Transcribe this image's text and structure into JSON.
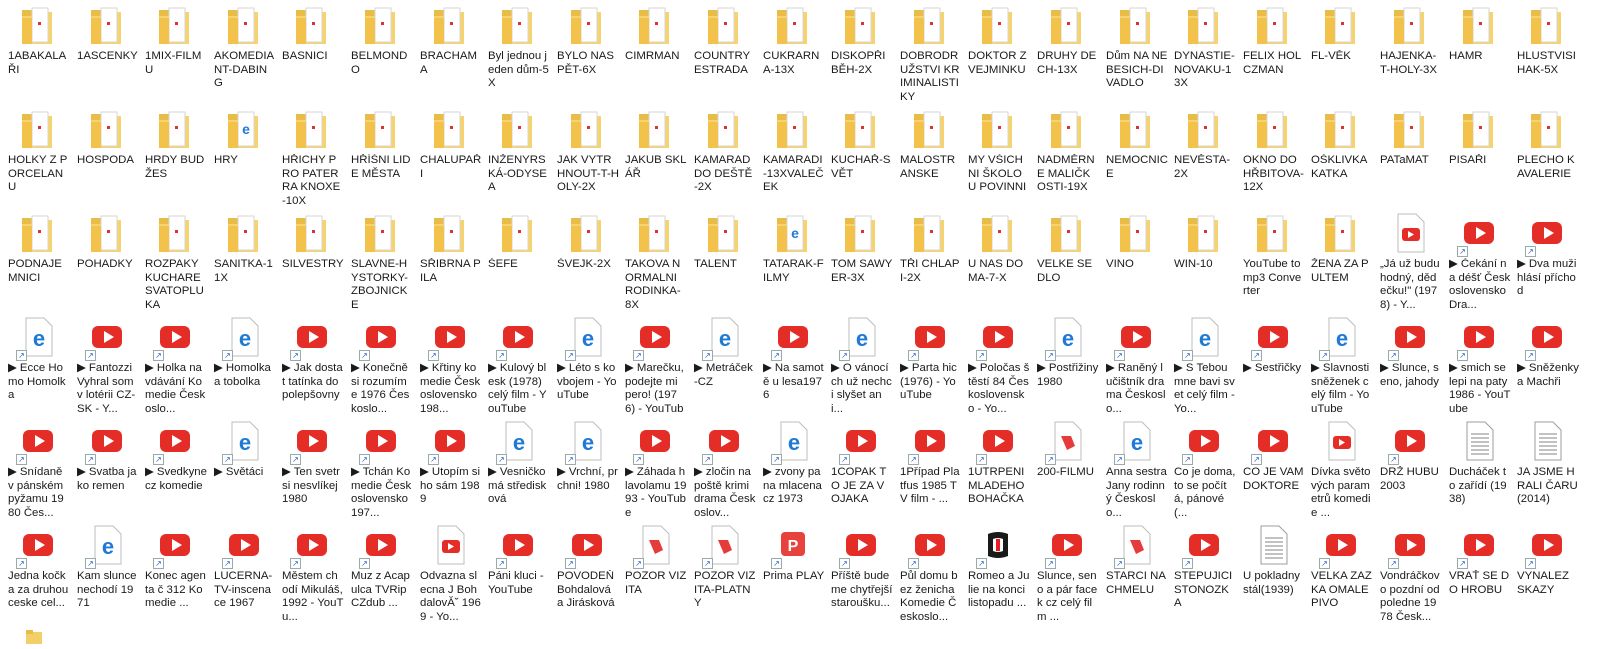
{
  "window": {
    "title": ""
  },
  "items": [
    {
      "label": "1ABAKALAŘI",
      "icon": "folder-icon"
    },
    {
      "label": "1ASCENKY",
      "icon": "folder-icon"
    },
    {
      "label": "1MIX-FILMU",
      "icon": "folder-icon"
    },
    {
      "label": "AKOMEDIANT-DABING",
      "icon": "folder-icon"
    },
    {
      "label": "BASNICI",
      "icon": "folder-icon"
    },
    {
      "label": "BELMONDO",
      "icon": "folder-icon"
    },
    {
      "label": "BRACHAMA",
      "icon": "folder-icon"
    },
    {
      "label": "Byl jednou jeden dům-5X",
      "icon": "folder-icon"
    },
    {
      "label": "BYLO NAS PĚT-6X",
      "icon": "folder-icon"
    },
    {
      "label": "CIMRMAN",
      "icon": "folder-icon"
    },
    {
      "label": "COUNTRY ESTRADA",
      "icon": "folder-icon"
    },
    {
      "label": "CUKRARNA-13X",
      "icon": "folder-icon"
    },
    {
      "label": "DISKOPŘIBĚH-2X",
      "icon": "folder-icon"
    },
    {
      "label": "DOBRODRUŽSTVI KRIMINALISTIKY",
      "icon": "folder-icon"
    },
    {
      "label": "DOKTOR Z VEJMINKU",
      "icon": "folder-icon"
    },
    {
      "label": "DRUHY DECH-13X",
      "icon": "folder-icon"
    },
    {
      "label": "Dům NA NEBESICH-DIVADLO",
      "icon": "folder-icon"
    },
    {
      "label": "DYNASTIE-NOVAKU-13X",
      "icon": "folder-icon"
    },
    {
      "label": "FELIX HOLCZMAN",
      "icon": "folder-icon"
    },
    {
      "label": "FL-VĚK",
      "icon": "folder-icon"
    },
    {
      "label": "HAJENKA-T-HOLY-3X",
      "icon": "folder-icon"
    },
    {
      "label": "HAMR",
      "icon": "folder-icon"
    },
    {
      "label": "HLUSTVISIHAK-5X",
      "icon": "folder-icon"
    },
    {
      "label": "HOLKY Z PORCELANU",
      "icon": "folder-icon"
    },
    {
      "label": "HOSPODA",
      "icon": "folder-icon"
    },
    {
      "label": "HRDY BUDŽES",
      "icon": "folder-icon"
    },
    {
      "label": "HRY",
      "icon": "folder-edge-icon"
    },
    {
      "label": "HŘICHY PRO PATERRA KNOXE-10X",
      "icon": "folder-icon"
    },
    {
      "label": "HŘÍŠNI LIDE MĚSTA",
      "icon": "folder-icon"
    },
    {
      "label": "CHALUPAŘI",
      "icon": "folder-icon"
    },
    {
      "label": "INŽENYRSKÁ-ODYSEA",
      "icon": "folder-icon"
    },
    {
      "label": "JAK VYTRHNOUT-T-HOLY-2X",
      "icon": "folder-icon"
    },
    {
      "label": "JAKUB SKLÁŘ",
      "icon": "folder-icon"
    },
    {
      "label": "KAMARAD DO DEŠTĚ-2X",
      "icon": "folder-icon"
    },
    {
      "label": "KAMARADI-13XVALEČEK",
      "icon": "folder-icon"
    },
    {
      "label": "KUCHAŘ-SVĚT",
      "icon": "folder-icon"
    },
    {
      "label": "MALOSTRANSKE",
      "icon": "folder-icon"
    },
    {
      "label": "MY VŠICHNI ŠKOLOU POVINNI",
      "icon": "folder-icon"
    },
    {
      "label": "NADMĚRNE MALIČKOSTI-19X",
      "icon": "folder-icon"
    },
    {
      "label": "NEMOCNICE",
      "icon": "folder-icon"
    },
    {
      "label": "NEVĚSTA-2X",
      "icon": "folder-icon"
    },
    {
      "label": "OKNO DO HŘBITOVA-12X",
      "icon": "folder-icon"
    },
    {
      "label": "OŠKLIVKA KATKA",
      "icon": "folder-icon"
    },
    {
      "label": "PATaMAT",
      "icon": "folder-icon"
    },
    {
      "label": "PISAŘI",
      "icon": "folder-icon"
    },
    {
      "label": "PLECHO KAVALERIE",
      "icon": "folder-icon"
    },
    {
      "label": "PODNAJEMNICI",
      "icon": "folder-icon"
    },
    {
      "label": "POHADKY",
      "icon": "folder-icon"
    },
    {
      "label": "ROZPAKY KUCHARE SVATOPLUKA",
      "icon": "folder-icon"
    },
    {
      "label": "SANITKA-11X",
      "icon": "folder-icon"
    },
    {
      "label": "SILVESTRY",
      "icon": "folder-icon"
    },
    {
      "label": "SLAVNE-HYSTORKY-ZBOJNICKE",
      "icon": "folder-icon"
    },
    {
      "label": "SŘIBRNA PILA",
      "icon": "folder-icon"
    },
    {
      "label": "ŠEFE",
      "icon": "folder-icon"
    },
    {
      "label": "ŠVEJK-2X",
      "icon": "folder-icon"
    },
    {
      "label": "TAKOVA NORMALNI RODINKA-8X",
      "icon": "folder-icon"
    },
    {
      "label": "TALENT",
      "icon": "folder-icon"
    },
    {
      "label": "TATARAK-FILMY",
      "icon": "folder-edge-icon"
    },
    {
      "label": "TOM SAWYER-3X",
      "icon": "folder-icon"
    },
    {
      "label": "TŘI CHLAPI-2X",
      "icon": "folder-icon"
    },
    {
      "label": "U NAS DOMA-7-X",
      "icon": "folder-icon"
    },
    {
      "label": "VELKE SEDLO",
      "icon": "folder-icon"
    },
    {
      "label": "VINO",
      "icon": "folder-icon"
    },
    {
      "label": "WIN-10",
      "icon": "folder-icon"
    },
    {
      "label": "YouTube to mp3 Converter",
      "icon": "folder-icon"
    },
    {
      "label": "ŽENA ZA PULTEM",
      "icon": "folder-icon"
    },
    {
      "label": "„Já už budu hodný, dědečku!\" (1978) - Y...",
      "icon": "youtube-file-icon"
    },
    {
      "label": "▶ Čekání na déšť Československo Dra...",
      "icon": "youtube-shortcut-icon"
    },
    {
      "label": "▶ Dva muži hlásí příchod",
      "icon": "youtube-shortcut-icon"
    },
    {
      "label": "▶ Ecce Homo Homolka",
      "icon": "edge-shortcut-icon"
    },
    {
      "label": "▶ Fantozzi Vyhral som v lotérii CZ-SK - Y...",
      "icon": "youtube-shortcut-icon"
    },
    {
      "label": "▶ Holka na vdávání Komedie Českoslo...",
      "icon": "youtube-shortcut-icon"
    },
    {
      "label": "▶ Homolka a tobolka",
      "icon": "edge-shortcut-icon"
    },
    {
      "label": "▶ Jak dostat tatínka do polepšovny",
      "icon": "youtube-shortcut-icon"
    },
    {
      "label": "▶ Konečně si rozumíme 1976 Českoslo...",
      "icon": "youtube-shortcut-icon"
    },
    {
      "label": "▶ Křtiny komedie Československo 198...",
      "icon": "youtube-shortcut-icon"
    },
    {
      "label": "▶ Kulový blesk (1978) celý film - YouTube",
      "icon": "youtube-shortcut-icon"
    },
    {
      "label": "▶ Léto s kovbojem - YouTube",
      "icon": "edge-shortcut-icon"
    },
    {
      "label": "▶ Marečku, podejte mi pero! (1976) - YouTube",
      "icon": "youtube-shortcut-icon"
    },
    {
      "label": "▶ Metráček -CZ",
      "icon": "edge-shortcut-icon"
    },
    {
      "label": "▶ Na samotě u lesa1976",
      "icon": "youtube-shortcut-icon"
    },
    {
      "label": "▶ O vánocích už nechci slyšet ani...",
      "icon": "edge-shortcut-icon"
    },
    {
      "label": "▶ Parta hic (1976) - YouTube",
      "icon": "youtube-shortcut-icon"
    },
    {
      "label": "▶ Poločas štěstí 84 Československo - Yo...",
      "icon": "youtube-shortcut-icon"
    },
    {
      "label": "▶ Postřižiny 1980",
      "icon": "edge-shortcut-icon"
    },
    {
      "label": "▶ Raněný lučištník drama Českoslo...",
      "icon": "youtube-shortcut-icon"
    },
    {
      "label": "▶ S Tebou mne bavi svet celý film - Yo...",
      "icon": "edge-shortcut-icon"
    },
    {
      "label": "▶ Sestřičky",
      "icon": "youtube-shortcut-icon"
    },
    {
      "label": "▶ Slavnosti sněženek celý film - YouTube",
      "icon": "edge-shortcut-icon"
    },
    {
      "label": "▶ Slunce, seno, jahody",
      "icon": "youtube-shortcut-icon"
    },
    {
      "label": "▶ smich se lepi na paty 1986 - YouTube",
      "icon": "youtube-shortcut-icon"
    },
    {
      "label": "▶ Sněženky a Machři",
      "icon": "youtube-shortcut-icon"
    },
    {
      "label": "▶ Snídaně v pánském pyžamu 1980 Čes...",
      "icon": "youtube-shortcut-icon"
    },
    {
      "label": "▶ Svatba jako remen",
      "icon": "youtube-shortcut-icon"
    },
    {
      "label": "▶ Svedkyne cz komedie",
      "icon": "youtube-shortcut-icon"
    },
    {
      "label": "▶ Světáci",
      "icon": "edge-shortcut-icon"
    },
    {
      "label": "▶ Ten svetr si nesvlíkej 1980",
      "icon": "youtube-shortcut-icon"
    },
    {
      "label": "▶ Tchán Komedie Československo 197...",
      "icon": "youtube-shortcut-icon"
    },
    {
      "label": "▶ Utopím si ho sám 1989",
      "icon": "youtube-shortcut-icon"
    },
    {
      "label": "▶ Vesničko má středisková",
      "icon": "edge-shortcut-icon"
    },
    {
      "label": "▶ Vrchní, prchni! 1980",
      "icon": "edge-shortcut-icon"
    },
    {
      "label": "▶ Záhada hlavolamu 1993 - YouTube",
      "icon": "youtube-shortcut-icon"
    },
    {
      "label": "▶ zločin na poště krimi drama Českoslov...",
      "icon": "youtube-shortcut-icon"
    },
    {
      "label": "▶ zvony pana mlacena cz 1973",
      "icon": "edge-shortcut-icon"
    },
    {
      "label": "1COPAK TO JE ZA VOJAKA",
      "icon": "youtube-shortcut-icon"
    },
    {
      "label": "1Případ Platfus 1985 TV film - ...",
      "icon": "youtube-shortcut-icon"
    },
    {
      "label": "1UTRPENI MLADEHO BOHAČKA",
      "icon": "youtube-shortcut-icon"
    },
    {
      "label": "200-FILMU",
      "icon": "red-app-icon"
    },
    {
      "label": "Anna sestra Jany rodinný Českoslo...",
      "icon": "edge-shortcut-icon"
    },
    {
      "label": "Co je doma, to se počítá, pánové (...",
      "icon": "youtube-shortcut-icon"
    },
    {
      "label": "CO JE VAM DOKTORE",
      "icon": "youtube-shortcut-icon"
    },
    {
      "label": "Dívka světových parametrů komedie ...",
      "icon": "youtube-file-icon"
    },
    {
      "label": "DRŽ HUBU 2003",
      "icon": "youtube-shortcut-icon"
    },
    {
      "label": "Ducháček to zařídí (1938)",
      "icon": "text-file-icon"
    },
    {
      "label": "JA JSME HRALI ČARU(2014)",
      "icon": "text-file-icon"
    },
    {
      "label": "Jedna kočka za druhou ceske cel...",
      "icon": "youtube-shortcut-icon"
    },
    {
      "label": "Kam slunce nechodí 1971",
      "icon": "edge-shortcut-icon"
    },
    {
      "label": "Konec agenta č 312 Komedie ...",
      "icon": "youtube-shortcut-icon"
    },
    {
      "label": "LUCERNA-TV-inscenace 1967",
      "icon": "youtube-shortcut-icon"
    },
    {
      "label": "Městem chodí Mikuláš,1992 - YouTu...",
      "icon": "youtube-shortcut-icon"
    },
    {
      "label": "Muz z Acapulca TVRip CZdub ...",
      "icon": "youtube-shortcut-icon"
    },
    {
      "label": "Odvazna slecna J BohdalovĂ˘ 1969 - Yo...",
      "icon": "youtube-file-icon"
    },
    {
      "label": "Páni kluci - YouTube",
      "icon": "youtube-shortcut-icon"
    },
    {
      "label": "POVODEŇ Bohdalová a Jirásková",
      "icon": "youtube-shortcut-icon"
    },
    {
      "label": "POZOR VIZITA",
      "icon": "red-app-icon"
    },
    {
      "label": "POZOR VIZITA-PLATNY",
      "icon": "red-app-icon"
    },
    {
      "label": "Prima PLAY",
      "icon": "prima-icon"
    },
    {
      "label": "Příště budeme chytřejší staroušku...",
      "icon": "youtube-shortcut-icon"
    },
    {
      "label": "Půl domu bez ženicha Komedie Českoslo...",
      "icon": "youtube-shortcut-icon"
    },
    {
      "label": "Romeo a Julie na konci listopadu ...",
      "icon": "ct-icon"
    },
    {
      "label": "Slunce, seno a pár facek cz celý film ...",
      "icon": "youtube-shortcut-icon"
    },
    {
      "label": "STARCI NA CHMELU",
      "icon": "red-app-icon"
    },
    {
      "label": "STEPUJICI STONOZKA",
      "icon": "youtube-shortcut-icon"
    },
    {
      "label": "U pokladny stál(1939)",
      "icon": "text-file-icon"
    },
    {
      "label": "VELKA ZAZKA OMALE PIVO",
      "icon": "youtube-shortcut-icon"
    },
    {
      "label": "Vondráčkovo pozdní odpoledne 1978 Česk...",
      "icon": "youtube-shortcut-icon"
    },
    {
      "label": "VRAŤ SE DO HROBU",
      "icon": "youtube-shortcut-icon"
    },
    {
      "label": "VYNALEZ SKAZY",
      "icon": "youtube-shortcut-icon"
    }
  ]
}
